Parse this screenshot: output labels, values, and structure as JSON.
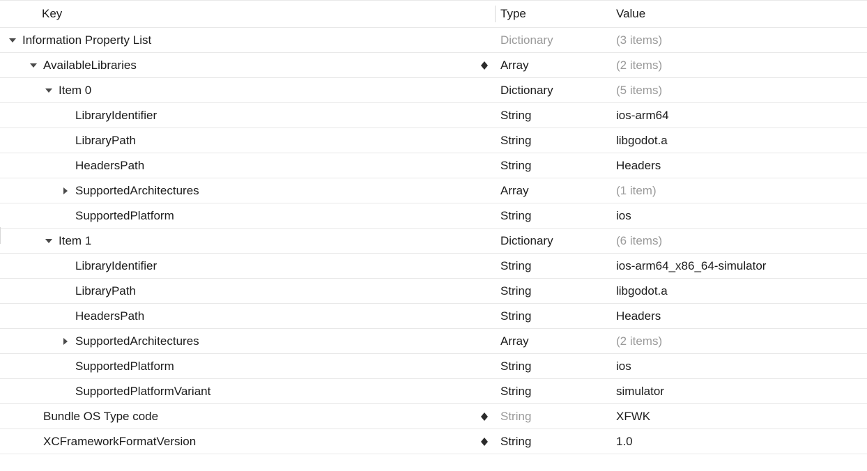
{
  "header": {
    "key": "Key",
    "type": "Type",
    "value": "Value"
  },
  "rows": [
    {
      "indent": 0,
      "disclosure": "down",
      "key": "Information Property List",
      "stepper": false,
      "type": "Dictionary",
      "typeFaded": true,
      "value": "(3 items)",
      "valueFaded": true
    },
    {
      "indent": 1,
      "disclosure": "down",
      "key": "AvailableLibraries",
      "stepper": true,
      "type": "Array",
      "typeFaded": false,
      "value": "(2 items)",
      "valueFaded": true
    },
    {
      "indent": 2,
      "disclosure": "down",
      "key": "Item 0",
      "stepper": false,
      "type": "Dictionary",
      "typeFaded": false,
      "value": "(5 items)",
      "valueFaded": true
    },
    {
      "indent": 3,
      "disclosure": "none",
      "key": "LibraryIdentifier",
      "stepper": false,
      "type": "String",
      "typeFaded": false,
      "value": "ios-arm64",
      "valueFaded": false
    },
    {
      "indent": 3,
      "disclosure": "none",
      "key": "LibraryPath",
      "stepper": false,
      "type": "String",
      "typeFaded": false,
      "value": "libgodot.a",
      "valueFaded": false
    },
    {
      "indent": 3,
      "disclosure": "none",
      "key": "HeadersPath",
      "stepper": false,
      "type": "String",
      "typeFaded": false,
      "value": "Headers",
      "valueFaded": false
    },
    {
      "indent": 3,
      "disclosure": "right",
      "key": "SupportedArchitectures",
      "stepper": false,
      "type": "Array",
      "typeFaded": false,
      "value": "(1 item)",
      "valueFaded": true
    },
    {
      "indent": 3,
      "disclosure": "none",
      "key": "SupportedPlatform",
      "stepper": false,
      "type": "String",
      "typeFaded": false,
      "value": "ios",
      "valueFaded": false
    },
    {
      "indent": 2,
      "disclosure": "down",
      "key": "Item 1",
      "stepper": false,
      "type": "Dictionary",
      "typeFaded": false,
      "value": "(6 items)",
      "valueFaded": true
    },
    {
      "indent": 3,
      "disclosure": "none",
      "key": "LibraryIdentifier",
      "stepper": false,
      "type": "String",
      "typeFaded": false,
      "value": "ios-arm64_x86_64-simulator",
      "valueFaded": false
    },
    {
      "indent": 3,
      "disclosure": "none",
      "key": "LibraryPath",
      "stepper": false,
      "type": "String",
      "typeFaded": false,
      "value": "libgodot.a",
      "valueFaded": false
    },
    {
      "indent": 3,
      "disclosure": "none",
      "key": "HeadersPath",
      "stepper": false,
      "type": "String",
      "typeFaded": false,
      "value": "Headers",
      "valueFaded": false
    },
    {
      "indent": 3,
      "disclosure": "right",
      "key": "SupportedArchitectures",
      "stepper": false,
      "type": "Array",
      "typeFaded": false,
      "value": "(2 items)",
      "valueFaded": true
    },
    {
      "indent": 3,
      "disclosure": "none",
      "key": "SupportedPlatform",
      "stepper": false,
      "type": "String",
      "typeFaded": false,
      "value": "ios",
      "valueFaded": false
    },
    {
      "indent": 3,
      "disclosure": "none",
      "key": "SupportedPlatformVariant",
      "stepper": false,
      "type": "String",
      "typeFaded": false,
      "value": "simulator",
      "valueFaded": false
    },
    {
      "indent": 1,
      "disclosure": "none",
      "key": "Bundle OS Type code",
      "stepper": true,
      "type": "String",
      "typeFaded": true,
      "value": "XFWK",
      "valueFaded": false
    },
    {
      "indent": 1,
      "disclosure": "none",
      "key": "XCFrameworkFormatVersion",
      "stepper": true,
      "type": "String",
      "typeFaded": false,
      "value": "1.0",
      "valueFaded": false
    }
  ]
}
